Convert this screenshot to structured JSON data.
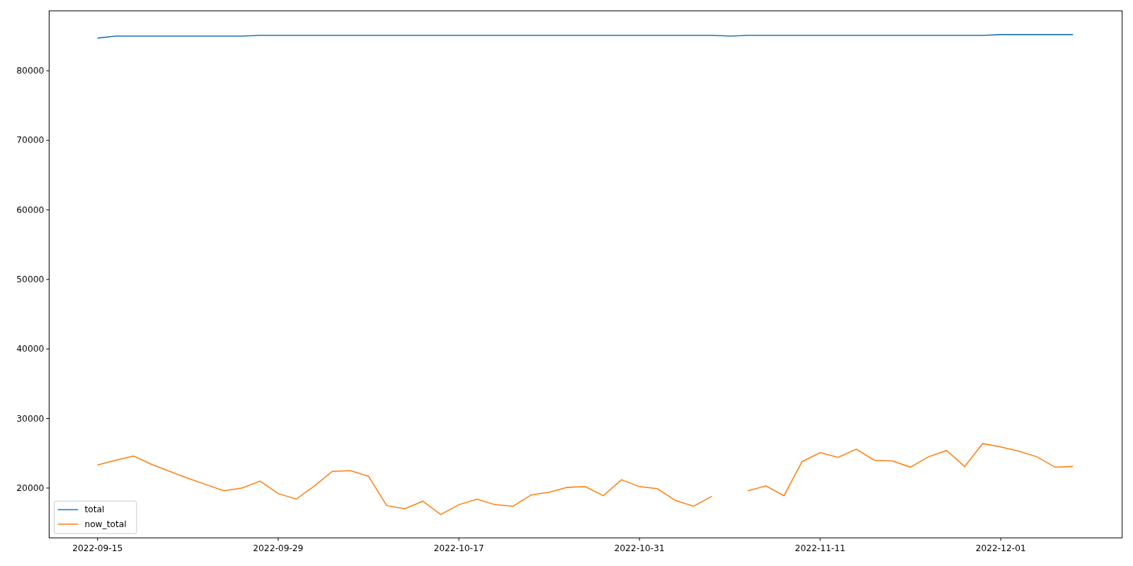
{
  "chart_data": {
    "type": "line",
    "categories": [
      "2022-09-15",
      null,
      null,
      null,
      null,
      null,
      null,
      null,
      null,
      null,
      "2022-09-29",
      null,
      null,
      null,
      null,
      null,
      null,
      null,
      null,
      null,
      "2022-10-17",
      null,
      null,
      null,
      null,
      null,
      null,
      null,
      null,
      null,
      "2022-10-31",
      null,
      null,
      null,
      null,
      null,
      null,
      null,
      null,
      null,
      "2022-11-11",
      null,
      null,
      null,
      null,
      null,
      null,
      null,
      null,
      null,
      "2022-12-01",
      null,
      null,
      null,
      null
    ],
    "series": [
      {
        "name": "total",
        "color": "#1f77b4",
        "values": [
          84700,
          85000,
          85000,
          85000,
          85000,
          85000,
          85000,
          85000,
          85000,
          85100,
          85100,
          85100,
          85100,
          85100,
          85100,
          85100,
          85100,
          85100,
          85100,
          85100,
          85100,
          85100,
          85100,
          85100,
          85100,
          85100,
          85100,
          85100,
          85100,
          85100,
          85100,
          85100,
          85100,
          85100,
          85100,
          85000,
          85100,
          85100,
          85100,
          85100,
          85100,
          85100,
          85100,
          85100,
          85100,
          85100,
          85100,
          85100,
          85100,
          85100,
          85200,
          85200,
          85200,
          85200,
          85200
        ]
      },
      {
        "name": "now_total",
        "color": "#ff7f0e",
        "values": [
          23300,
          24000,
          24600,
          23400,
          22400,
          21400,
          20500,
          19600,
          20000,
          21000,
          19200,
          18400,
          20300,
          22400,
          22500,
          21700,
          17500,
          17000,
          18100,
          16200,
          17600,
          18400,
          17600,
          17400,
          19000,
          19400,
          20100,
          20200,
          18900,
          21200,
          20200,
          19900,
          18200,
          17400,
          18800,
          null,
          19600,
          20300,
          18900,
          23800,
          25100,
          24400,
          25600,
          24000,
          23900,
          23000,
          24500,
          25400,
          23100,
          26400,
          25900,
          25300,
          24500,
          23000,
          23100
        ]
      }
    ],
    "legend": true,
    "ylim": [
      12840,
      88620
    ],
    "yticks": [
      20000,
      30000,
      40000,
      50000,
      60000,
      70000,
      80000
    ]
  }
}
